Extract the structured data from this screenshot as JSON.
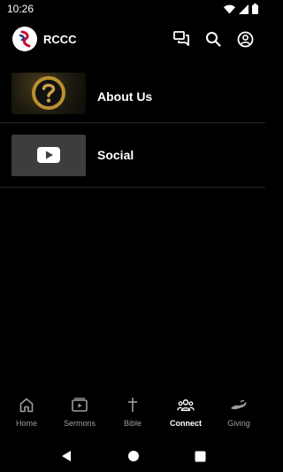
{
  "status_bar": {
    "time": "10:26"
  },
  "app_bar": {
    "title": "RCCC"
  },
  "list": [
    {
      "label": "About Us",
      "thumbnail": "question-mark-icon"
    },
    {
      "label": "Social",
      "thumbnail": "youtube-play-icon"
    }
  ],
  "bottom_nav": {
    "items": [
      {
        "label": "Home",
        "icon": "home-icon",
        "active": false
      },
      {
        "label": "Sermons",
        "icon": "video-play-icon",
        "active": false
      },
      {
        "label": "Bible",
        "icon": "cross-icon",
        "active": false
      },
      {
        "label": "Connect",
        "icon": "group-icon",
        "active": true
      },
      {
        "label": "Giving",
        "icon": "giving-hand-icon",
        "active": false
      }
    ]
  },
  "colors": {
    "background": "#000000",
    "divider": "#262626",
    "inactive": "#9e9e9e",
    "active": "#ffffff",
    "logo_red": "#c8102e",
    "logo_blue": "#1f3a93"
  }
}
